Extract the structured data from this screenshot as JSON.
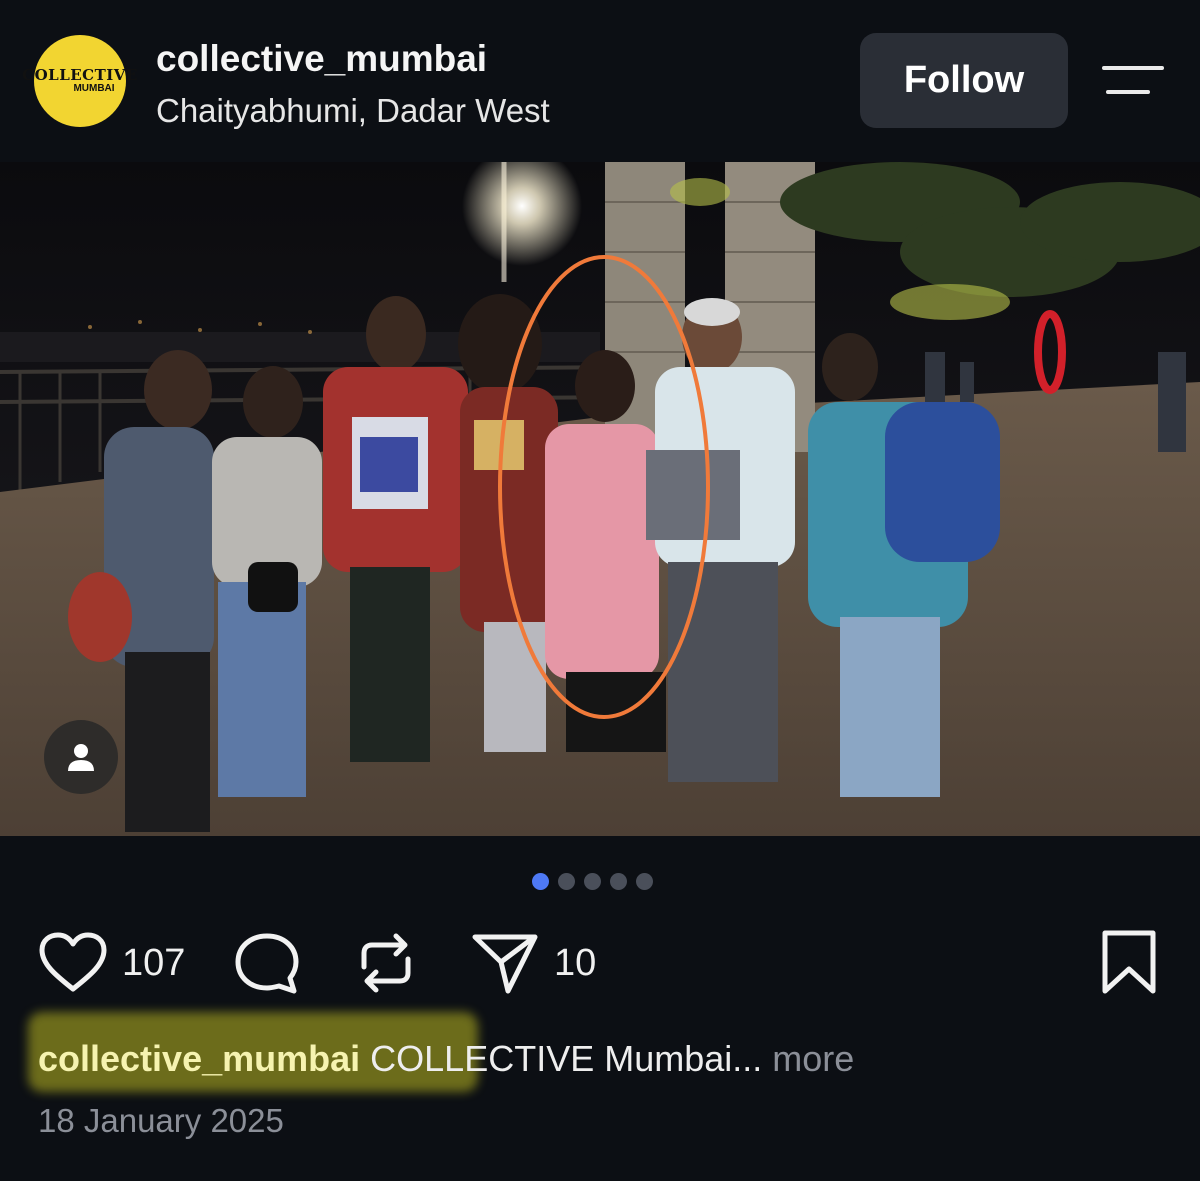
{
  "header": {
    "avatar_line1": "COLLECTIVE",
    "avatar_line2": "MUMBAI",
    "username": "collective_mumbai",
    "location": "Chaityabhumi, Dadar West",
    "follow_label": "Follow"
  },
  "carousel": {
    "count": 5,
    "active_index": 0
  },
  "actions": {
    "likes": "107",
    "shares": "10"
  },
  "caption": {
    "username": "collective_mumbai",
    "text": "COLLECTIVE Mumbai...",
    "more_label": "more"
  },
  "date": "18 January 2025",
  "icons": [
    "heart-icon",
    "comment-icon",
    "repost-icon",
    "share-icon",
    "bookmark-icon",
    "menu-icon",
    "person-icon"
  ],
  "colors": {
    "accent": "#4e79f5",
    "follow_bg": "#2a2e36",
    "annotation_circle": "#f07a3a",
    "highlight": "#e2de23"
  }
}
